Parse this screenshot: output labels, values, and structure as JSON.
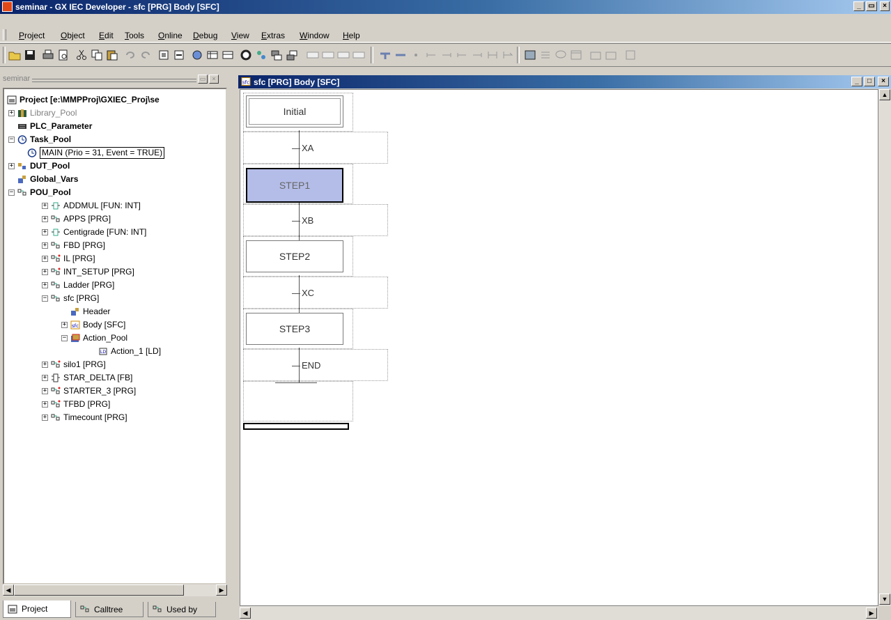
{
  "window": {
    "title": "seminar - GX IEC Developer - sfc [PRG] Body [SFC]",
    "min": "_",
    "max": " ",
    "close": "×"
  },
  "menu": [
    "Project",
    "Object",
    "Edit",
    "Tools",
    "Online",
    "Debug",
    "View",
    "Extras",
    "Window",
    "Help"
  ],
  "left_panel": {
    "title": "seminar",
    "tree": {
      "root": "Project [e:\\MMPProj\\GXIEC_Proj\\se",
      "library_pool": "Library_Pool",
      "plc_parameter": "PLC_Parameter",
      "task_pool": "Task_Pool",
      "main_task": "MAIN (Prio = 31, Event = TRUE)",
      "dut_pool": "DUT_Pool",
      "global_vars": "Global_Vars",
      "pou_pool": "POU_Pool",
      "pous": [
        "ADDMUL [FUN: INT]",
        "APPS [PRG]",
        "Centigrade [FUN: INT]",
        "FBD [PRG]",
        "IL [PRG]",
        "INT_SETUP [PRG]",
        "Ladder [PRG]",
        "sfc [PRG]"
      ],
      "sfc_children": {
        "header": "Header",
        "body": "Body [SFC]",
        "action_pool": "Action_Pool",
        "action_1": "Action_1 [LD]"
      },
      "pous_after": [
        "silo1 [PRG]",
        "STAR_DELTA [FB]",
        "STARTER_3 [PRG]",
        "TFBD [PRG]",
        "Timecount [PRG]"
      ]
    },
    "tabs": [
      "Project",
      "Calltree",
      "Used by"
    ]
  },
  "document": {
    "title": "sfc [PRG] Body [SFC]",
    "sfc": {
      "initial": "Initial",
      "steps": [
        "STEP1",
        "STEP2",
        "STEP3"
      ],
      "transitions": [
        "XA",
        "XB",
        "XC",
        "END"
      ]
    }
  },
  "colors": {
    "title_bar": "#0a246a",
    "selected_step": "#b4bde8"
  }
}
